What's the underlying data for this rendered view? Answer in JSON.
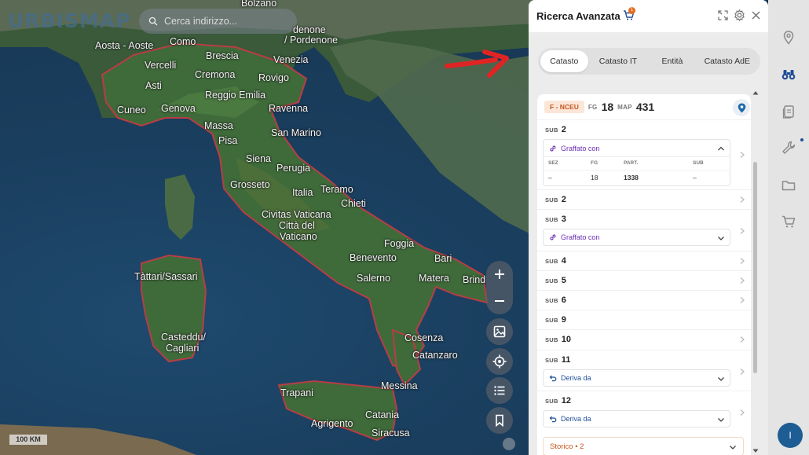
{
  "app": {
    "logo": "URBISMAP",
    "search_placeholder": "Cerca indirizzo...",
    "scale": "100 KM"
  },
  "map_labels": [
    {
      "id": "bolzano",
      "text": "Bolzano"
    },
    {
      "id": "pordenone",
      "text": "/ Pordenone"
    },
    {
      "id": "udine",
      "text": "denone"
    },
    {
      "id": "aosta",
      "text": "Aosta - Aoste"
    },
    {
      "id": "como",
      "text": "Como"
    },
    {
      "id": "brescia",
      "text": "Brescia"
    },
    {
      "id": "venezia",
      "text": "Venezia"
    },
    {
      "id": "vercelli",
      "text": "Vercelli"
    },
    {
      "id": "cremona",
      "text": "Cremona"
    },
    {
      "id": "rovigo",
      "text": "Rovigo"
    },
    {
      "id": "asti",
      "text": "Asti"
    },
    {
      "id": "reggio",
      "text": "Reggio Emilia"
    },
    {
      "id": "cuneo",
      "text": "Cuneo"
    },
    {
      "id": "genova",
      "text": "Genova"
    },
    {
      "id": "ravenna",
      "text": "Ravenna"
    },
    {
      "id": "massa",
      "text": "Massa"
    },
    {
      "id": "sanmarino",
      "text": "San Marino"
    },
    {
      "id": "pisa",
      "text": "Pisa"
    },
    {
      "id": "siena",
      "text": "Siena"
    },
    {
      "id": "perugia",
      "text": "Perugia"
    },
    {
      "id": "grosseto",
      "text": "Grosseto"
    },
    {
      "id": "italia",
      "text": "Italia"
    },
    {
      "id": "teramo",
      "text": "Teramo"
    },
    {
      "id": "chieti",
      "text": "Chieti"
    },
    {
      "id": "civitas",
      "text": "Civitas Vaticana"
    },
    {
      "id": "citta",
      "text": "Città del"
    },
    {
      "id": "vaticano",
      "text": "Vaticano"
    },
    {
      "id": "foggia",
      "text": "Foggia"
    },
    {
      "id": "tattari",
      "text": "Tàttari/Sassari"
    },
    {
      "id": "benevento",
      "text": "Benevento"
    },
    {
      "id": "bari",
      "text": "Bari"
    },
    {
      "id": "salerno",
      "text": "Salerno"
    },
    {
      "id": "matera",
      "text": "Matera"
    },
    {
      "id": "brindisi",
      "text": "Brind"
    },
    {
      "id": "casteddu",
      "text": "Casteddu/"
    },
    {
      "id": "cagliari",
      "text": "Cagliari"
    },
    {
      "id": "cosenza",
      "text": "Cosenza"
    },
    {
      "id": "catanzaro",
      "text": "Catanzaro"
    },
    {
      "id": "messina",
      "text": "Messina"
    },
    {
      "id": "trapani",
      "text": "Trapani"
    },
    {
      "id": "catania",
      "text": "Catania"
    },
    {
      "id": "agrigento",
      "text": "Agrigento"
    },
    {
      "id": "siracusa",
      "text": "Siracusa"
    }
  ],
  "panel": {
    "title": "Ricerca Avanzata",
    "cart_badge": "1",
    "tabs": [
      "Catasto",
      "Catasto IT",
      "Entità",
      "Catasto AdE"
    ],
    "active_tab": "Catasto",
    "record": {
      "tag": "F - NCEU",
      "fg_key": "FG",
      "fg_val": "18",
      "map_key": "MAP",
      "map_val": "431"
    },
    "sub_key": "SUB",
    "subs": [
      {
        "num": "2"
      },
      {
        "num": "2"
      },
      {
        "num": "3"
      },
      {
        "num": "4"
      },
      {
        "num": "5"
      },
      {
        "num": "6"
      },
      {
        "num": "9"
      },
      {
        "num": "10"
      },
      {
        "num": "11"
      },
      {
        "num": "12"
      }
    ],
    "graffato_label": "Graffato con",
    "deriva_label": "Deriva da",
    "table_headers": [
      "SEZ",
      "FG",
      "PART.",
      "SUB"
    ],
    "table_row": [
      "–",
      "18",
      "1338",
      "–"
    ],
    "storico": "Storico • 2"
  },
  "sidebar": {
    "avatar_initial": "I"
  },
  "colors": {
    "accent": "#1f4e96",
    "orange": "#c8551b",
    "purple": "#6b2fb3",
    "arrow": "#e02424"
  }
}
